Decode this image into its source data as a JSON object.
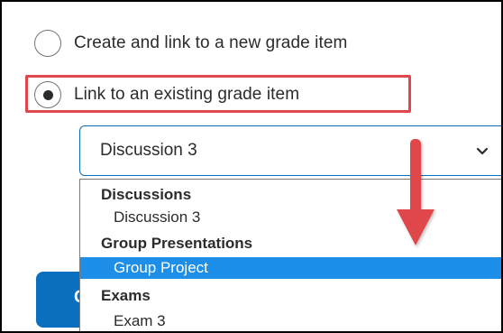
{
  "options": {
    "create_new_label": "Create and link to a new grade item",
    "link_existing_label": "Link to an existing grade item"
  },
  "select": {
    "value": "Discussion 3",
    "chevron_icon": "chevron-down-icon"
  },
  "dropdown": {
    "groups": [
      {
        "label": "Discussions",
        "items": [
          {
            "label": "Discussion 3",
            "selected": false
          }
        ]
      },
      {
        "label": "Group Presentations",
        "items": [
          {
            "label": "Group Project",
            "selected": true
          }
        ]
      },
      {
        "label": "Exams",
        "items": [
          {
            "label": "Exam 3",
            "selected": false
          }
        ]
      }
    ]
  },
  "button": {
    "label": "C"
  },
  "annotation": {
    "highlight_color": "#e0474c",
    "arrow_icon": "arrow-down-icon"
  },
  "colors": {
    "accent": "#0b6fbf",
    "selected_row": "#1e8fe8",
    "text": "#2b2b2b"
  }
}
